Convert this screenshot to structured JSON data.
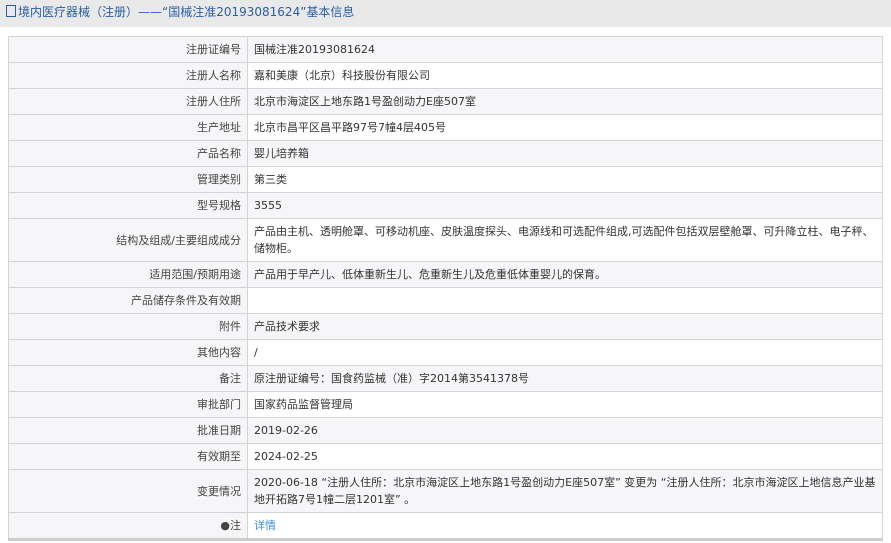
{
  "title": "境内医疗器械（注册）——“国械注准20193081624”基本信息",
  "rows": [
    {
      "label": "注册证编号",
      "value": "国械注准20193081624"
    },
    {
      "label": "注册人名称",
      "value": "嘉和美康（北京）科技股份有限公司"
    },
    {
      "label": "注册人住所",
      "value": "北京市海淀区上地东路1号盈创动力E座507室"
    },
    {
      "label": "生产地址",
      "value": "北京市昌平区昌平路97号7幢4层405号"
    },
    {
      "label": "产品名称",
      "value": "婴儿培养箱"
    },
    {
      "label": "管理类别",
      "value": "第三类"
    },
    {
      "label": "型号规格",
      "value": "3555"
    },
    {
      "label": "结构及组成/主要组成成分",
      "value": "产品由主机、透明舱罩、可移动机座、皮肤温度探头、电源线和可选配件组成,可选配件包括双层壁舱罩、可升降立柱、电子秤、储物柜。"
    },
    {
      "label": "适用范围/预期用途",
      "value": "产品用于早产儿、低体重新生儿、危重新生儿及危重低体重婴儿的保育。"
    },
    {
      "label": "产品储存条件及有效期",
      "value": ""
    },
    {
      "label": "附件",
      "value": "产品技术要求"
    },
    {
      "label": "其他内容",
      "value": "/"
    },
    {
      "label": "备注",
      "value": "原注册证编号：国食药监械（准）字2014第3541378号"
    },
    {
      "label": "审批部门",
      "value": "国家药品监督管理局"
    },
    {
      "label": "批准日期",
      "value": "2019-02-26"
    },
    {
      "label": "有效期至",
      "value": "2024-02-25"
    },
    {
      "label": "变更情况",
      "value": "2020-06-18 “注册人住所：北京市海淀区上地东路1号盈创动力E座507室” 变更为 “注册人住所：北京市海淀区上地信息产业基地开拓路7号1幢二层1201室” 。"
    }
  ],
  "note": {
    "label": "注",
    "link": "详情"
  }
}
